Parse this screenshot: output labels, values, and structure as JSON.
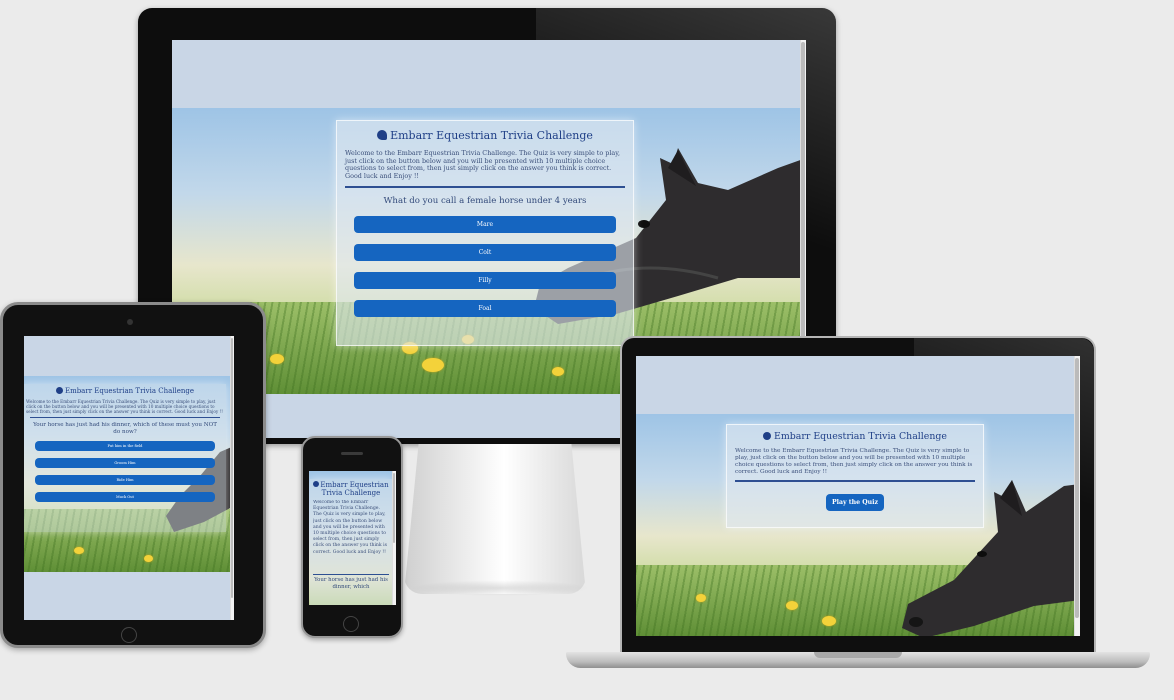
{
  "app": {
    "title": "Embarr Equestrian Trivia Challenge"
  },
  "intro": "Welcome to the Embarr Equestrian Trivia Challenge. The Quiz is very simple to play, just click on the button below and you will be presented with 10 multiple choice questions to select from, then just simply click on the answer you think is correct. Good luck and Enjoy !!",
  "desktop": {
    "question": "What do you call a female horse under 4 years",
    "answers": [
      "Mare",
      "Colt",
      "Filly",
      "Foal"
    ]
  },
  "tablet": {
    "question": "Your horse has just had his dinner, which of these must you NOT do now?",
    "answers": [
      "Put him in the field",
      "Groom Him",
      "Ride Him",
      "Muck Out"
    ]
  },
  "phone": {
    "title": "Embarr Equestrian Trivia Challenge",
    "question_partial": "Your horse has just had his dinner, which"
  },
  "laptop": {
    "play_label": "Play the Quiz"
  },
  "colors": {
    "accent": "#1565c0",
    "heading": "#1f3f87",
    "background": "#ebebeb"
  }
}
